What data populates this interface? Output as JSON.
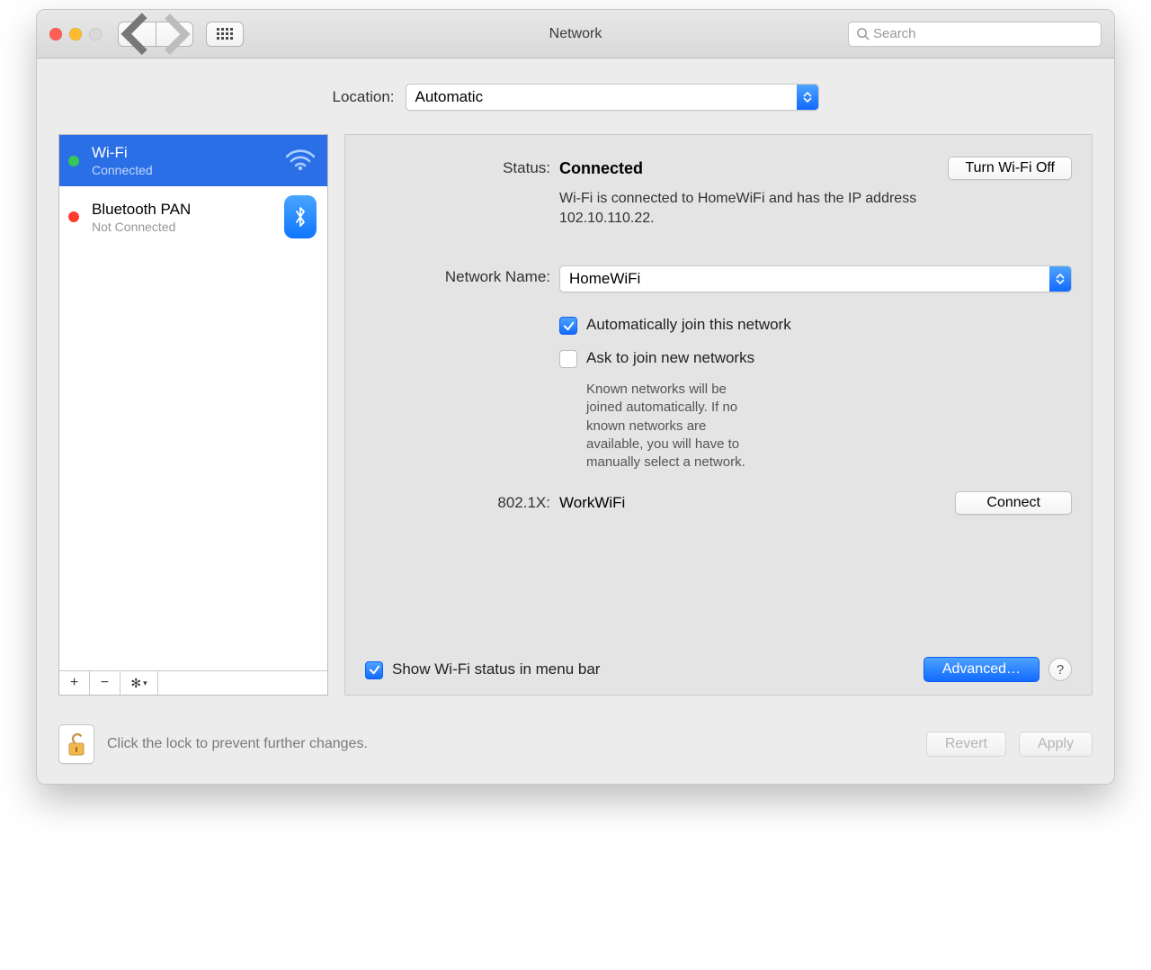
{
  "window": {
    "title": "Network",
    "search_placeholder": "Search"
  },
  "location": {
    "label": "Location:",
    "value": "Automatic"
  },
  "sidebar": {
    "items": [
      {
        "name": "Wi-Fi",
        "sub": "Connected",
        "status": "green",
        "icon": "wifi",
        "selected": true
      },
      {
        "name": "Bluetooth PAN",
        "sub": "Not Connected",
        "status": "red",
        "icon": "bluetooth",
        "selected": false
      }
    ],
    "add_label": "+",
    "remove_label": "−",
    "gear_label": "⚙︎"
  },
  "detail": {
    "status_label": "Status:",
    "status_value": "Connected",
    "wifi_toggle": "Turn Wi-Fi Off",
    "status_desc": "Wi-Fi is connected to HomeWiFi and has the IP address 102.10.110.22.",
    "network_name_label": "Network Name:",
    "network_name_value": "HomeWiFi",
    "auto_join": {
      "checked": true,
      "label": "Automatically join this network"
    },
    "ask_join": {
      "checked": false,
      "label": "Ask to join new networks",
      "help": "Known networks will be joined automatically. If no known networks are available, you will have to manually select a network."
    },
    "dot1x_label": "802.1X:",
    "dot1x_name": "WorkWiFi",
    "dot1x_button": "Connect",
    "show_menubar": {
      "checked": true,
      "label": "Show Wi-Fi status in menu bar"
    },
    "advanced_button": "Advanced…",
    "help_button": "?"
  },
  "footer": {
    "lock_text": "Click the lock to prevent further changes.",
    "revert": "Revert",
    "apply": "Apply"
  }
}
